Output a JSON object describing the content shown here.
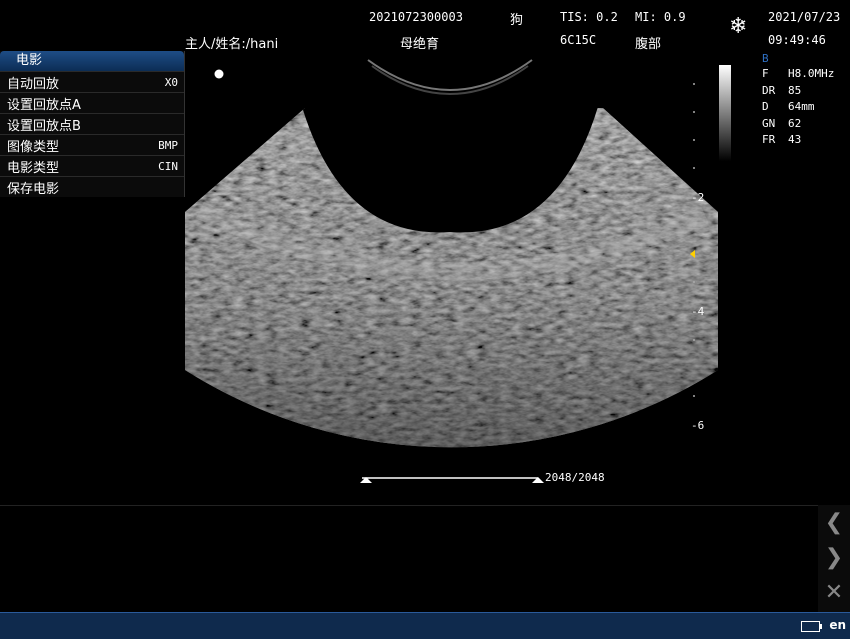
{
  "header": {
    "exam_id": "2021072300003",
    "species": "狗",
    "tis": "TIS: 0.2",
    "mi": "MI: 0.9",
    "date": "2021/07/23",
    "patient": "主人/姓名:/hani",
    "exam_type": "母绝育",
    "probe": "6C15C",
    "region": "腹部",
    "time": "09:49:46"
  },
  "menu": {
    "title": "电影",
    "items": [
      {
        "label": "自动回放",
        "value": "X0"
      },
      {
        "label": "设置回放点A",
        "value": ""
      },
      {
        "label": "设置回放点B",
        "value": ""
      },
      {
        "label": "图像类型",
        "value": "BMP"
      },
      {
        "label": "电影类型",
        "value": "CIN"
      },
      {
        "label": "保存电影",
        "value": ""
      }
    ]
  },
  "params": {
    "mode": "B",
    "rows": [
      {
        "k": "F",
        "v": "H8.0MHz"
      },
      {
        "k": "DR",
        "v": "85"
      },
      {
        "k": "D",
        "v": "64mm"
      },
      {
        "k": "GN",
        "v": "62"
      },
      {
        "k": "FR",
        "v": "43"
      }
    ]
  },
  "depth_scale": [
    "-2",
    "-4",
    "-6"
  ],
  "cine": {
    "frame": "2048/2048",
    "position": 1.0
  },
  "taskbar": {
    "lang": "en"
  },
  "colors": {
    "accent": "#1e4d86",
    "focus_marker": "#ffd000",
    "taskbar": "#0f2a4d"
  }
}
